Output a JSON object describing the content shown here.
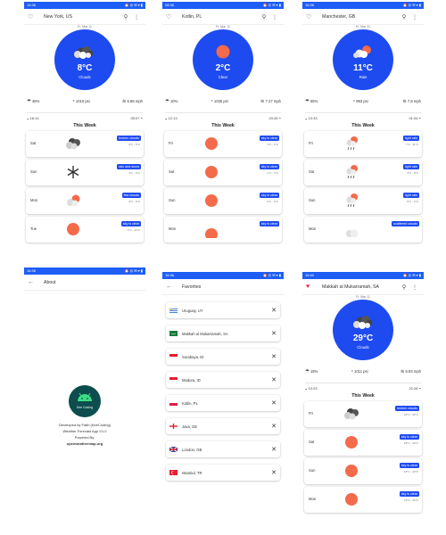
{
  "screens": [
    {
      "status": {
        "time": "16:36",
        "right": "⏰ ◎ ✉ ▾ ▮"
      },
      "city": "New York, US",
      "date": "Fr, Mar 11",
      "temp": "8°C",
      "desc": "Clouds",
      "humidity": "46%",
      "pressure": "1010 psi",
      "wind": "5.86 mph",
      "sunrise": "18:14",
      "sunset": "05:07",
      "week_title": "This Week",
      "days": [
        {
          "day": "Sat",
          "badge": "broken clouds",
          "range": "0°C - 5°C"
        },
        {
          "day": "Sun",
          "badge": "rain and snow",
          "range": "4°C - 6°C"
        },
        {
          "day": "Mon",
          "badge": "few clouds",
          "range": "4°C - 9°C"
        },
        {
          "day": "Tue",
          "badge": "sky is clear",
          "range": "1°C - 12°C"
        }
      ]
    },
    {
      "status": {
        "time": "08:36",
        "right": "⏰ ◎ ✉ ▾ ▮"
      },
      "city": "Kotlin, PL",
      "date": "Fr, Mar 11",
      "temp": "2°C",
      "desc": "Clear",
      "humidity": "10%",
      "pressure": "1035 psi",
      "wind": "7.27 mph",
      "sunrise": "12:13",
      "sunset": "23:45",
      "week_title": "This Week",
      "days": [
        {
          "day": "Fri",
          "badge": "sky is clear",
          "range": "1°C - 2°C"
        },
        {
          "day": "Sat",
          "badge": "sky is clear",
          "range": "-1°C - 3°C"
        },
        {
          "day": "Sun",
          "badge": "sky is clear",
          "range": "0°C - 5°C"
        },
        {
          "day": "Mon",
          "badge": "sky is clear",
          "range": ""
        }
      ]
    },
    {
      "status": {
        "time": "16:36",
        "right": "⏰ ◎ ✉ ▾ ▮"
      },
      "city": "Manchester, GB",
      "date": "Fr, Mar 11",
      "temp": "11°C",
      "desc": "Rain",
      "humidity": "65%",
      "pressure": "993 psi",
      "wind": "7.8 mph",
      "sunrise": "13:33",
      "sunset": "01:04",
      "week_title": "This Week",
      "days": [
        {
          "day": "Fri",
          "badge": "light rain",
          "range": "7°C - 11°C"
        },
        {
          "day": "Sat",
          "badge": "light rain",
          "range": "4°C - 8°C"
        },
        {
          "day": "Sun",
          "badge": "light rain",
          "range": "5°C - 9°C"
        },
        {
          "day": "Mon",
          "badge": "scattered clouds",
          "range": ""
        }
      ]
    },
    {
      "status": {
        "time": "16:36",
        "right": "⏰ ◎ ✉ ▾ ▮"
      },
      "title": "About",
      "logo_text": "Kee Coding",
      "lines": [
        "Developed by Fatih (KeeCoding)",
        "Weather Forecast App V1.0",
        "Powered By:",
        "openweathermap.org"
      ]
    },
    {
      "status": {
        "time": "16:36",
        "right": "⏰ ◎ ✉ ▾ ▮"
      },
      "title": "Favorites",
      "items": [
        {
          "label": "Uruguay, UY"
        },
        {
          "label": "Makkah al Mukarramah, SA"
        },
        {
          "label": "Surabaya, ID"
        },
        {
          "label": "Madura, ID"
        },
        {
          "label": "Kotlin, PL"
        },
        {
          "label": "Java, GE"
        },
        {
          "label": "London, GB"
        },
        {
          "label": "Istanbul, TR"
        }
      ]
    },
    {
      "status": {
        "time": "16:40",
        "right": "⏰ ◎ ✉ ▾ ▮"
      },
      "city": "Makkah al Mukarramah, SA",
      "date": "Fr, Mar 11",
      "temp": "29°C",
      "desc": "Clouds",
      "humidity": "19%",
      "pressure": "1011 psi",
      "wind": "6.93 mph",
      "sunrise": "10:23",
      "sunset": "22:28",
      "week_title": "This Week",
      "days": [
        {
          "day": "Fri",
          "badge": "broken clouds",
          "range": "24°C - 30°C"
        },
        {
          "day": "Sat",
          "badge": "sky is clear",
          "range": "18°C - 30°C"
        },
        {
          "day": "Sun",
          "badge": "sky is clear",
          "range": "18°C - 33°C"
        },
        {
          "day": "Mon",
          "badge": "sky is clear",
          "range": "19°C - 30°C"
        }
      ]
    }
  ],
  "colors": {
    "accent": "#1e4bf0",
    "status_bar": "#1e5ef5",
    "sun": "#f36b4a",
    "heart": "#e02040"
  },
  "icons": {
    "favorite": "heart-outline-icon",
    "favorite_active": "heart-filled-icon",
    "search": "search-icon",
    "menu": "more-vert-icon",
    "back": "arrow-back-icon",
    "remove": "close-icon",
    "humidity": "humidity-icon",
    "pressure": "pressure-gauge-icon",
    "wind": "wind-icon",
    "sunrise": "sunrise-icon",
    "sunset": "sunset-icon"
  }
}
